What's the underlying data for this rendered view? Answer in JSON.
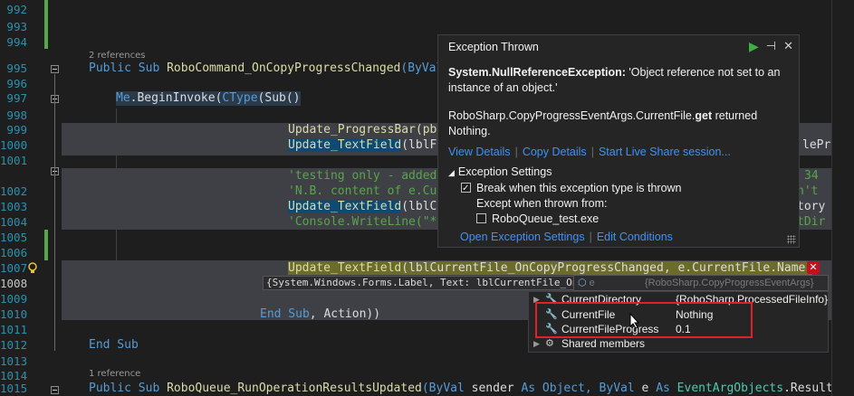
{
  "editor": {
    "line_numbers": [
      "992",
      "993",
      "994",
      "995",
      "996",
      "997",
      "998",
      "999",
      "1000",
      "1001",
      "1002",
      "1003",
      "1004",
      "1005",
      "1006",
      "1007",
      "1008",
      "1009",
      "1010",
      "1011",
      "1012",
      "1013",
      "1014",
      "1015"
    ],
    "codelens_2refs": "2 references",
    "codelens_1ref": "1 reference",
    "code": {
      "l995_kw": "Public Sub ",
      "l995_fn": "RoboCommand_OnCopyProgressChanged",
      "l995_rest": "(ByVal",
      "l997_me": "Me",
      "l997_call": ".BeginInvoke(",
      "l997_ctype": "CType",
      "l997_sub": "(Sub()",
      "l998": "Update_ProgressBar(pbF",
      "l999_fn": "Update_TextField",
      "l999_rest": "(lblFi",
      "l999_right": "lePr",
      "l1001": "'testing only - added",
      "l1001_right": "34",
      "l1002": "'N.B. content of e.Cur",
      "l1002_right": "n't",
      "l1003_fn": "Update_TextField",
      "l1003_rest": "(lblCu",
      "l1003_right": "tory",
      "l1004": "'Console.WriteLine(\"**",
      "l1004_right": "tDir",
      "l1008_fn": "Update_TextField",
      "l1008_rest": "(lblCurrentFile_OnCopyProgressChanged, e.CurrentFile.Name)",
      "l1011_end": "End Sub",
      "l1011_rest": ", Action))",
      "l1013": "End Sub",
      "l1015_kw": "Public Sub ",
      "l1015_fn": "RoboQueue_RunOperationResultsUpdated",
      "l1015_p1": "(ByVal ",
      "l1015_p2": "sender ",
      "l1015_p3": "As Object",
      "l1015_p4": ", ByVal ",
      "l1015_p5": "e ",
      "l1015_p6": "As ",
      "l1015_p7": "EventArgObjects",
      "l1015_p8": ".ResultLi"
    }
  },
  "exception_popup": {
    "title": "Exception Thrown",
    "exception_type": "System.NullReferenceException:",
    "message": " 'Object reference not set to an instance of an object.'",
    "detail_prefix": "RoboSharp.CopyProgressEventArgs.CurrentFile.",
    "detail_bold": "get",
    "detail_suffix": " returned Nothing.",
    "links": [
      "View Details",
      "Copy Details",
      "Start Live Share session..."
    ],
    "settings_header": "Exception Settings",
    "break_when_label": "Break when this exception type is thrown",
    "except_when_label": "Except when thrown from:",
    "module_label": "RoboQueue_test.exe",
    "bottom_links": [
      "Open Exception Settings",
      "Edit Conditions"
    ]
  },
  "datatip": {
    "main_value": "{System.Windows.Forms.Label, Text: lblCurrentFile_OnCopyPr",
    "rest_prefix": " e",
    "rest_value": "{RoboSharp.CopyProgressEventArgs}",
    "rows": [
      {
        "name": "CurrentDirectory",
        "value": "{RoboSharp.ProcessedFileInfo}"
      },
      {
        "name": "CurrentFile",
        "value": "Nothing"
      },
      {
        "name": "CurrentFileProgress",
        "value": "0.1"
      },
      {
        "name": "Shared members",
        "value": ""
      }
    ]
  },
  "colors": {
    "keyword": "#569cd6",
    "function": "#dcdcaa",
    "comment": "#57a64a",
    "link": "#3794ff",
    "error": "#c50f1f",
    "highlight_box": "#e0202a"
  }
}
